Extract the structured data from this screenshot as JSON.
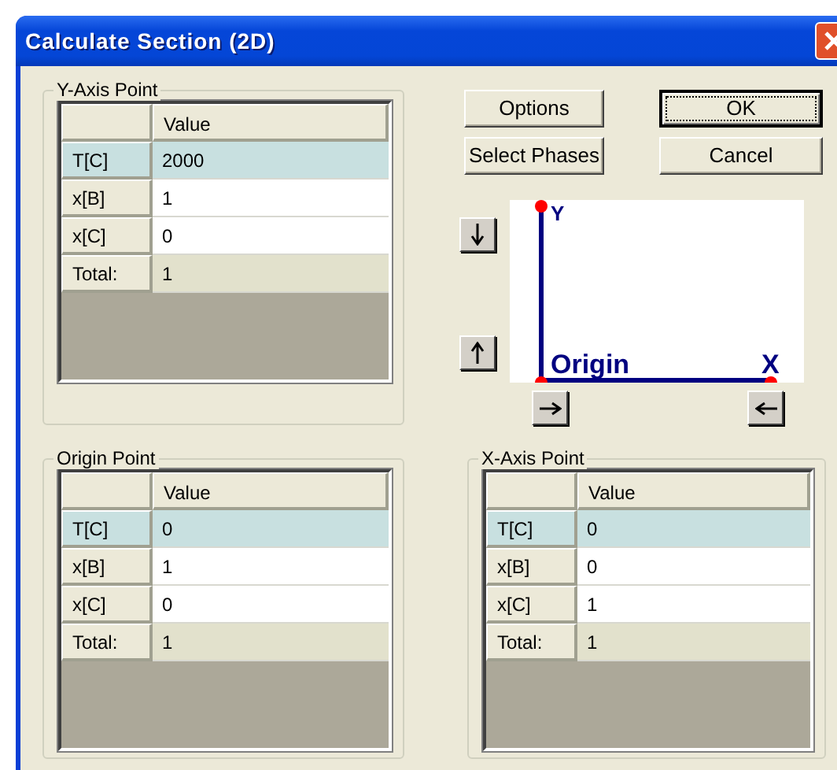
{
  "window": {
    "title": "Calculate Section (2D)"
  },
  "buttons": [
    {
      "label": "Options",
      "default": false
    },
    {
      "label": "OK",
      "default": true
    },
    {
      "label": "Select Phases",
      "default": false
    },
    {
      "label": "Cancel",
      "default": false
    }
  ],
  "diagram": {
    "y_label": "Y",
    "origin_label": "Origin",
    "x_label": "X"
  },
  "groups": [
    {
      "title": "Y-Axis Point",
      "column": "Value",
      "rows": [
        {
          "label": "T[C]",
          "value": "2000",
          "kind": "entry",
          "selected": true
        },
        {
          "label": "x[B]",
          "value": "1",
          "kind": "entry",
          "selected": false
        },
        {
          "label": "x[C]",
          "value": "0",
          "kind": "entry",
          "selected": false
        },
        {
          "label": "Total:",
          "value": "1",
          "kind": "total",
          "selected": false
        }
      ]
    },
    {
      "title": "Origin Point",
      "column": "Value",
      "rows": [
        {
          "label": "T[C]",
          "value": "0",
          "kind": "entry",
          "selected": true
        },
        {
          "label": "x[B]",
          "value": "1",
          "kind": "entry",
          "selected": false
        },
        {
          "label": "x[C]",
          "value": "0",
          "kind": "entry",
          "selected": false
        },
        {
          "label": "Total:",
          "value": "1",
          "kind": "total",
          "selected": false
        }
      ]
    },
    {
      "title": "X-Axis Point",
      "column": "Value",
      "rows": [
        {
          "label": "T[C]",
          "value": "0",
          "kind": "entry",
          "selected": true
        },
        {
          "label": "x[B]",
          "value": "0",
          "kind": "entry",
          "selected": false
        },
        {
          "label": "x[C]",
          "value": "1",
          "kind": "entry",
          "selected": false
        },
        {
          "label": "Total:",
          "value": "1",
          "kind": "total",
          "selected": false
        }
      ]
    }
  ]
}
